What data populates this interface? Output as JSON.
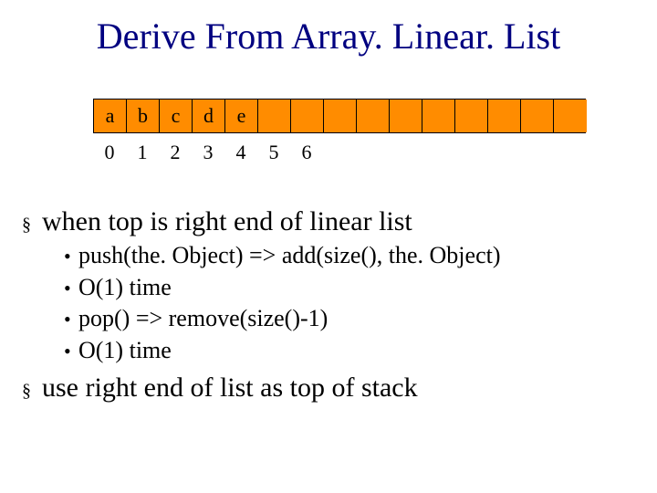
{
  "title": "Derive From Array. Linear. List",
  "array": {
    "cells": [
      "a",
      "b",
      "c",
      "d",
      "e",
      "",
      "",
      "",
      "",
      "",
      "",
      "",
      "",
      "",
      ""
    ],
    "indices": [
      "0",
      "1",
      "2",
      "3",
      "4",
      "5",
      "6"
    ]
  },
  "bullets": [
    {
      "level": 1,
      "text": "when top is right end of linear list"
    },
    {
      "level": 2,
      "text": "push(the. Object) => add(size(), the. Object)"
    },
    {
      "level": 2,
      "text": "O(1) time"
    },
    {
      "level": 2,
      "text": "pop() => remove(size()-1)"
    },
    {
      "level": 2,
      "text": "O(1) time"
    },
    {
      "level": 1,
      "text": "use right end of list as top of stack"
    }
  ],
  "marks": {
    "square": "§",
    "dot": "•"
  }
}
